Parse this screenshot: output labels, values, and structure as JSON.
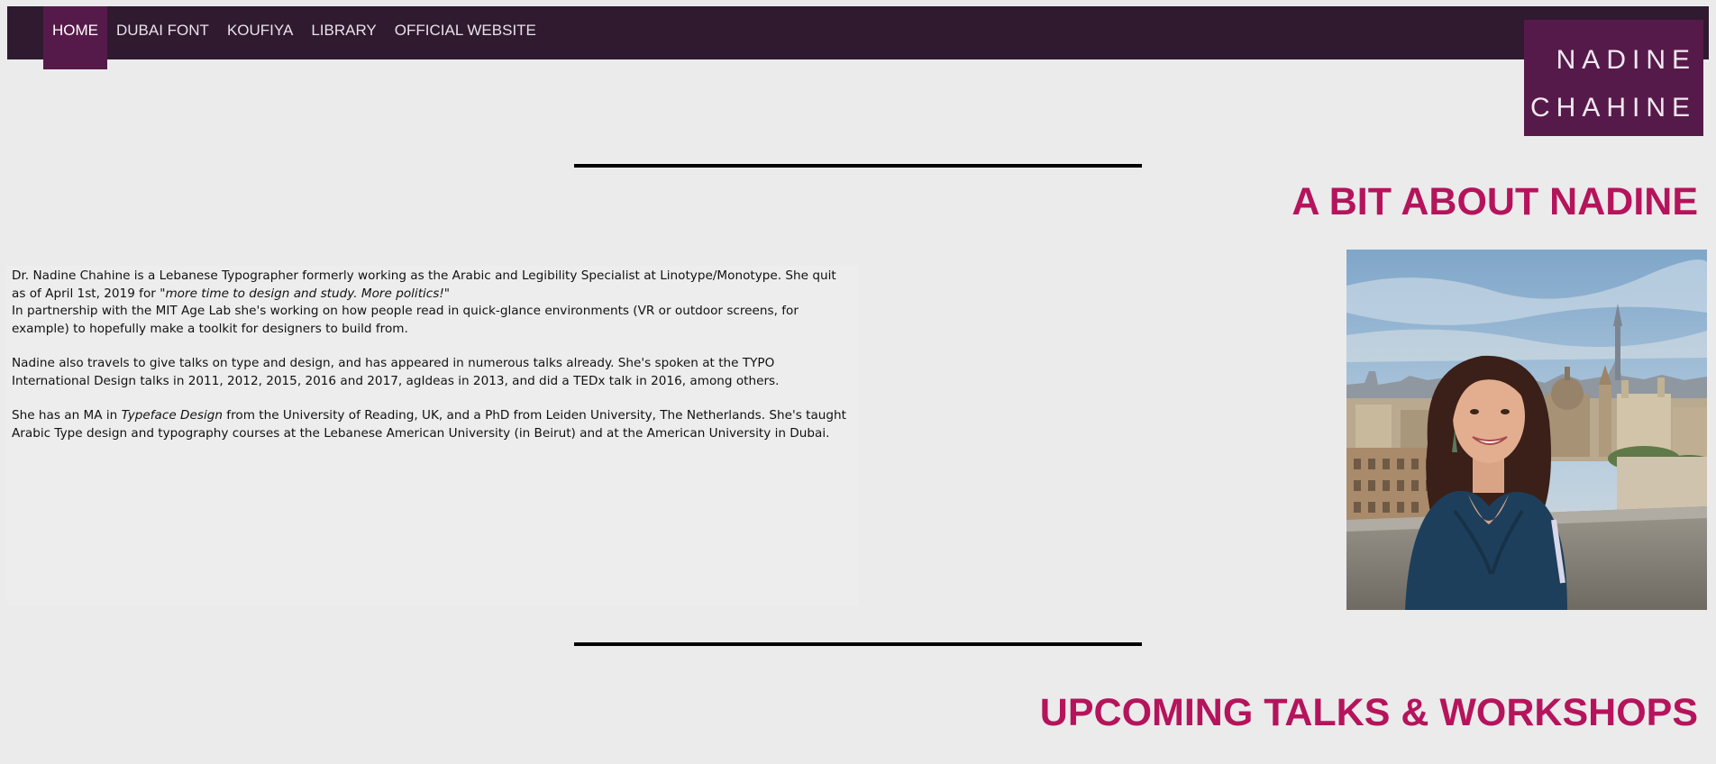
{
  "nav": {
    "items": [
      {
        "label": "HOME"
      },
      {
        "label": "DUBAI FONT"
      },
      {
        "label": "KOUFIYA"
      },
      {
        "label": "LIBRARY"
      },
      {
        "label": "OFFICIAL WEBSITE"
      }
    ],
    "active_item": "HOME"
  },
  "logo": {
    "line1": "NADINE",
    "line2": "CHAHINE"
  },
  "about": {
    "heading": "A BIT ABOUT NADINE",
    "p1_text": "Dr. Nadine Chahine is a Lebanese Typographer formerly working as the Arabic and Legibility Specialist at Linotype/Monotype. She quit as of April 1st, 2019 for ",
    "p1_quote": "\"more time to design and study. More politics!\"",
    "p1_line2": "In partnership with the MIT Age Lab she's working on how people read in quick-glance environments (VR or outdoor screens, for example) to hopefully make a toolkit for designers to build from.",
    "p2": "Nadine also travels to give talks on type and design, and has appeared in numerous talks already. She's spoken at the TYPO International Design talks in 2011, 2012, 2015, 2016 and 2017, agIdeas in 2013, and did a TEDx talk in 2016, among others.",
    "p3_before": "She has an MA in ",
    "p3_italic": "Typeface Design",
    "p3_after": " from the University of Reading, UK, and a PhD from Leiden University, The Netherlands. She's taught Arabic Type design and typography courses at the Lebanese American University (in Beirut) and at the American University in Dubai."
  },
  "talks": {
    "heading": "UPCOMING TALKS & WORKSHOPS"
  },
  "colors": {
    "nav_bg": "#2f1a2f",
    "accent": "#561a4a",
    "heading": "#b5145c",
    "page_bg": "#ebebeb"
  }
}
